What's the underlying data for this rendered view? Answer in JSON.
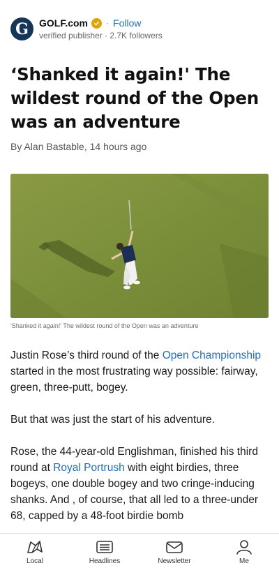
{
  "publisher": {
    "logo_letter": "G",
    "name": "GOLF.com",
    "follow_label": "Follow",
    "subtitle": "verified publisher · 2.7K followers"
  },
  "article": {
    "headline": "‘Shanked it again!' The wildest round of the Open was an adventure",
    "byline": "By Alan Bastable, 14 hours ago",
    "image_caption": "'Shanked it again!' The wildest round of the Open was an adventure",
    "paragraph1": {
      "before": "Justin Rose’s third round of the ",
      "link": "Open Championship",
      "after": " started in the most frustrating way possible: fairway, green, three-putt, bogey."
    },
    "paragraph2": "But that was just the start of his adventure.",
    "paragraph3": {
      "before": "Rose, the 44-year-old Englishman, finished his third round at ",
      "link": "Royal Portrush",
      "after": " with eight birdies, three bogeys, one double bogey and two cringe-inducing shanks. And , of course, that all led to a three-under 68, capped by a 48-foot birdie bomb"
    }
  },
  "bottom_nav": {
    "items": [
      {
        "label": "Local",
        "icon": "map-icon"
      },
      {
        "label": "Headlines",
        "icon": "newspaper-icon"
      },
      {
        "label": "Newsletter",
        "icon": "mail-icon"
      },
      {
        "label": "Me",
        "icon": "person-icon"
      }
    ]
  },
  "colors": {
    "link": "#1f6ec9",
    "logo_bg": "#15365a",
    "verified": "#e2a400"
  }
}
